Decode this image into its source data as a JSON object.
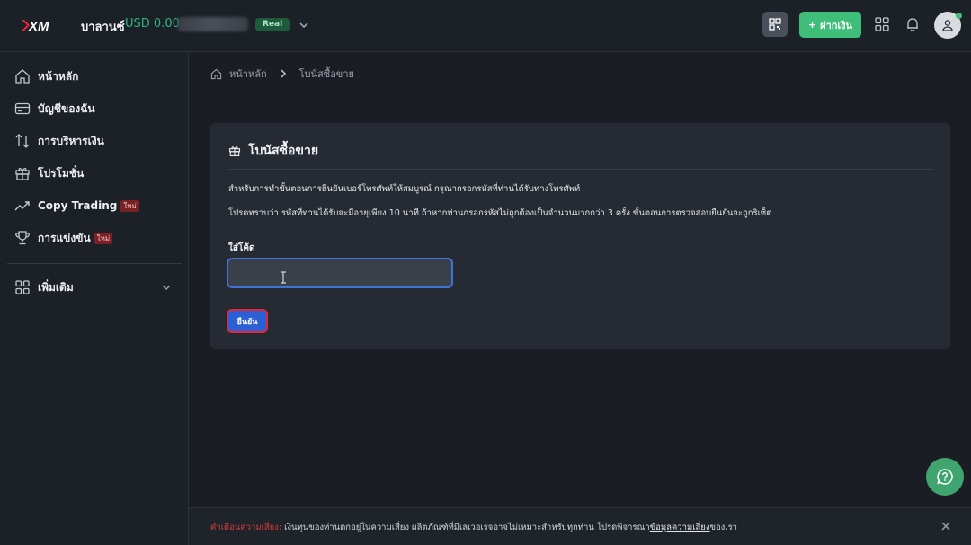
{
  "header": {
    "balance_label": "บาลานซ์",
    "balance_value": "USD 0.00",
    "account_type": "Real",
    "deposit_label": "ฝากเงิน",
    "deposit_plus": "+"
  },
  "sidebar": {
    "items": [
      {
        "label": "หน้าหลัก",
        "icon": "home-icon"
      },
      {
        "label": "บัญชีของฉัน",
        "icon": "card-icon"
      },
      {
        "label": "การบริหารเงิน",
        "icon": "transfer-arrows-icon"
      },
      {
        "label": "โปรโมชั่น",
        "icon": "gift-icon"
      },
      {
        "label": "Copy Trading",
        "icon": "trending-up-icon",
        "badge": "ใหม่"
      },
      {
        "label": "การแข่งขัน",
        "icon": "trophy-icon",
        "badge": "ใหม่"
      }
    ],
    "more_label": "เพิ่มเติม"
  },
  "breadcrumb": {
    "home": "หน้าหลัก",
    "current": "โบนัสซื้อขาย"
  },
  "card": {
    "title": "โบนัสซื้อขาย",
    "line1": "สำหรับการทำขั้นตอนการยืนยันเบอร์โทรศัพท์ให้สมบูรณ์ กรุณากรอกรหัสที่ท่านได้รับทางโทรศัพท์",
    "line2": "โปรดทราบว่า รหัสที่ท่านได้รับจะมีอายุเพียง 10 นาที ถ้าหากท่านกรอกรหัสไม่ถูกต้องเป็นจำนวนมากกว่า 3 ครั้ง ขั้นตอนการตรวจสอบยืนยันจะถูกริเซ็ต",
    "code_label": "ใส่โค้ด",
    "code_value": "",
    "confirm_label": "ยืนยัน"
  },
  "risk": {
    "warning": "คำเตือนความเสี่ยง:",
    "text": " เงินทุนของท่านตกอยู่ในความเสี่ยง ผลิตภัณฑ์ที่มีเลเวอเรจอาจไม่เหมาะสำหรับทุกท่าน โปรดพิจารณา",
    "link": "ข้อมูลความเสี่ยง",
    "suffix": "ของเรา"
  },
  "colors": {
    "accent_green": "#3fbe7a",
    "primary_blue": "#2c5fd6",
    "danger_red": "#d93a3a"
  }
}
